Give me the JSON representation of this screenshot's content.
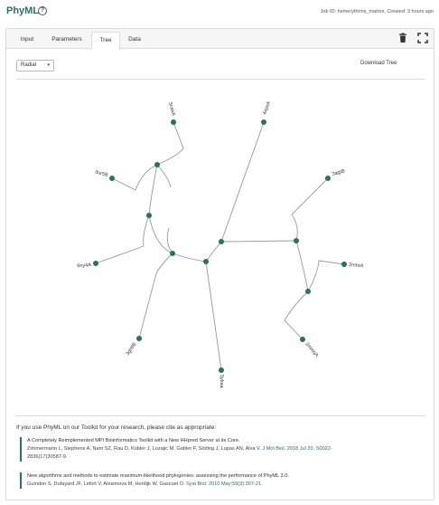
{
  "app": {
    "title": "PhyML",
    "job_info": "Job ID: hemerythrins_matrex,  Created: 3 hours ago"
  },
  "tabs": [
    {
      "label": "Input"
    },
    {
      "label": "Parameters"
    },
    {
      "label": "Tree",
      "active": true
    },
    {
      "label": "Data"
    }
  ],
  "toolbar": {
    "layout_select": "Radial",
    "download_label": "Download Tree"
  },
  "tree": {
    "leaf_labels": [
      "3caxA",
      "4xpxA",
      "3ur5B",
      "3agtB",
      "6ny4A",
      "2mhrA",
      "3gh9B",
      "2mmqA",
      "5ykaa"
    ],
    "branch_color": "#999999",
    "node_color": "#2e6f65"
  },
  "citations": {
    "intro": "If you use PhyML on our Toolkit for your research, please cite as appropriate:",
    "items": [
      {
        "title": "A Completely Reimplemented MPI Bioinformatics Toolkit with a New HHpred Server at its Core.",
        "authors": "Zimmermann L, Stephens A, Nam SZ, Rau D, Kübler J, Lozajic M, Gabler F, Söding J, Lupas AN, Alva V.",
        "journal": "J Mol Biol. 2018 Jul 20. S0022-",
        "extra": "2836(17)30587-9."
      },
      {
        "title": "New algorithms and methods to estimate maximum-likelihood phylogenies: assessing the performance of PhyML 3.0.",
        "authors": "Guindon S, Dufayard JF, Lefort V, Anisimova M, Hordijk W, Gascuel O.",
        "journal": "Syst Biol. 2010 May;59(3):307-21."
      }
    ]
  }
}
